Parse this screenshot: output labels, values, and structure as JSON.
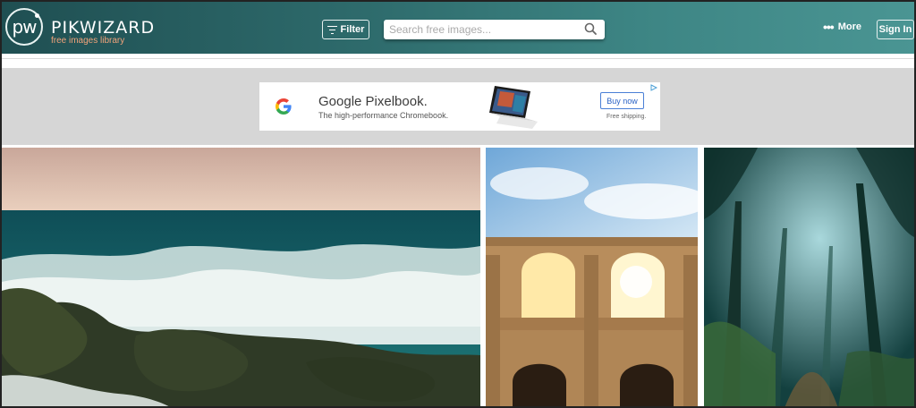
{
  "header": {
    "logo_text": "pw",
    "brand": "PIKWIZARD",
    "tagline": "free images library",
    "filter_label": "Filter",
    "search_placeholder": "Search free images...",
    "more_label": "More",
    "more_icon": "ellipsis-icon",
    "signin_label": "Sign In"
  },
  "ad": {
    "title": "Google Pixelbook.",
    "subtitle": "The high-performance Chromebook.",
    "button_label": "Buy now",
    "shipping": "Free shipping."
  },
  "colors": {
    "header_start": "#1f4f52",
    "header_end": "#4a9593",
    "tagline": "#f2a37a",
    "ad_band": "#d6d6d6"
  },
  "images": [
    {
      "subject": "ocean waves crashing on rocks"
    },
    {
      "subject": "ancient stone arches with sunlight"
    },
    {
      "subject": "misty forest path"
    }
  ]
}
